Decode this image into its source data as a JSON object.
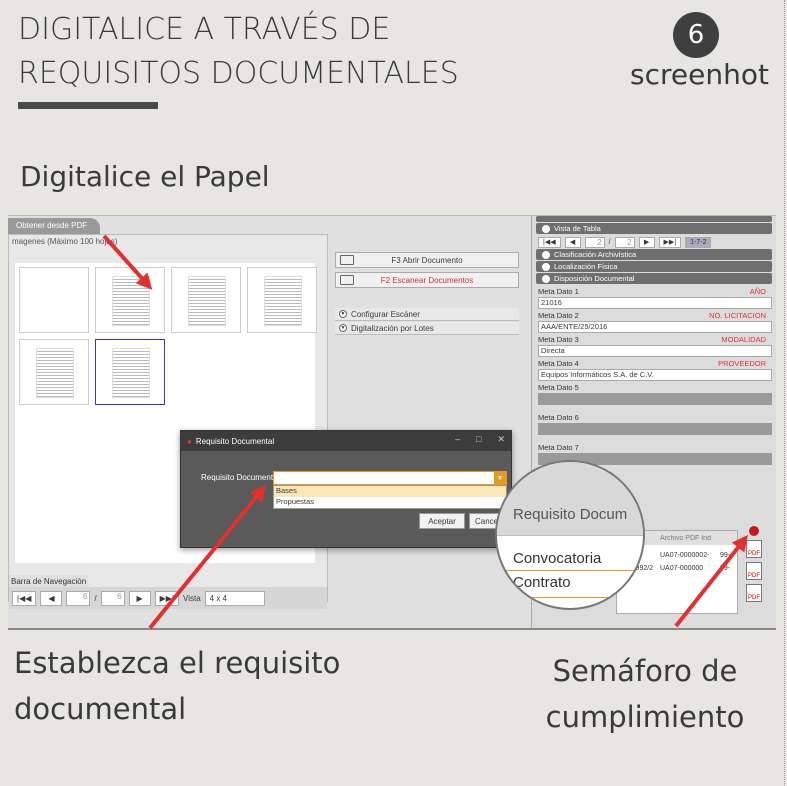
{
  "header": {
    "title_line1": "DIGITALICE A TRAVÉS DE",
    "title_line2": "REQUISITOS DOCUMENTALES",
    "badge_number": "6",
    "badge_text": "screenhot"
  },
  "subtitle": "Digitalice el Papel",
  "caption_left_line1": "Establezca el requisito",
  "caption_left_line2": "documental",
  "caption_right_line1": "Semáforo de",
  "caption_right_line2": "cumplimiento",
  "app": {
    "tab_pdf": "Obtener desde PDF",
    "images_label": "magenes (Máximo 100 hojas)",
    "open_doc": "F3 Abrir Documento",
    "scan_docs": "F2 Escanear Documentos",
    "config_scanner": "Configurar Escáner",
    "batch_digit": "Digitalización por Lotes",
    "nav_bar_label": "Barra de Navegación",
    "nav": {
      "first": "|◀◀",
      "prev": "◀",
      "page": "6",
      "sep": "/",
      "total": "6",
      "next": "▶",
      "last": "▶▶|",
      "view_label": "Vista",
      "view_value": "4 x 4"
    },
    "right": {
      "vista_tabla": "Vista de Tabla",
      "rnav_page": "2",
      "rnav_sep": "/",
      "rnav_total": "2",
      "rnav_range": "1-7-2",
      "clasificacion": "Clasificación Archivística",
      "localizacion": "Localización Física",
      "disposicion": "Disposición Documental",
      "meta": [
        {
          "label": "Meta Dato 1",
          "tag": "AÑO",
          "value": "21016"
        },
        {
          "label": "Meta Dato 2",
          "tag": "NO. LICITACION",
          "value": "AAA/ENTE/25/2016"
        },
        {
          "label": "Meta Dato 3",
          "tag": "MODALIDAD",
          "value": "Directa"
        },
        {
          "label": "Meta Dato 4",
          "tag": "PROVEEDOR",
          "value": "Equipos Informáticos S.A. de C.V."
        },
        {
          "label": "Meta Dato 5",
          "tag": "",
          "value": ""
        },
        {
          "label": "Meta Dato 6",
          "tag": "",
          "value": ""
        },
        {
          "label": "Meta Dato 7",
          "tag": "",
          "value": ""
        }
      ]
    },
    "dialog": {
      "title": "Requisito Documental",
      "label": "Requisito Documental",
      "options": [
        "Bases",
        "Propuestas"
      ],
      "accept": "Aceptar",
      "cancel": "Cancelar"
    },
    "zoom": {
      "header": "Requisito Docum",
      "items": [
        "Convocatoria",
        "Contrato"
      ]
    },
    "table": {
      "headers": [
        "encia",
        "Archivo PDF Ind"
      ],
      "rows": [
        [
          "nexo",
          "UA07-0000002-",
          "99-"
        ],
        [
          "AS-0992/2",
          "UA07-000000",
          "99-"
        ]
      ]
    }
  },
  "colors": {
    "background": "#e8e6e3",
    "accent_orange": "#e89a20",
    "arrow_red": "#e03030",
    "semaforo_red": "#c21a1a"
  }
}
